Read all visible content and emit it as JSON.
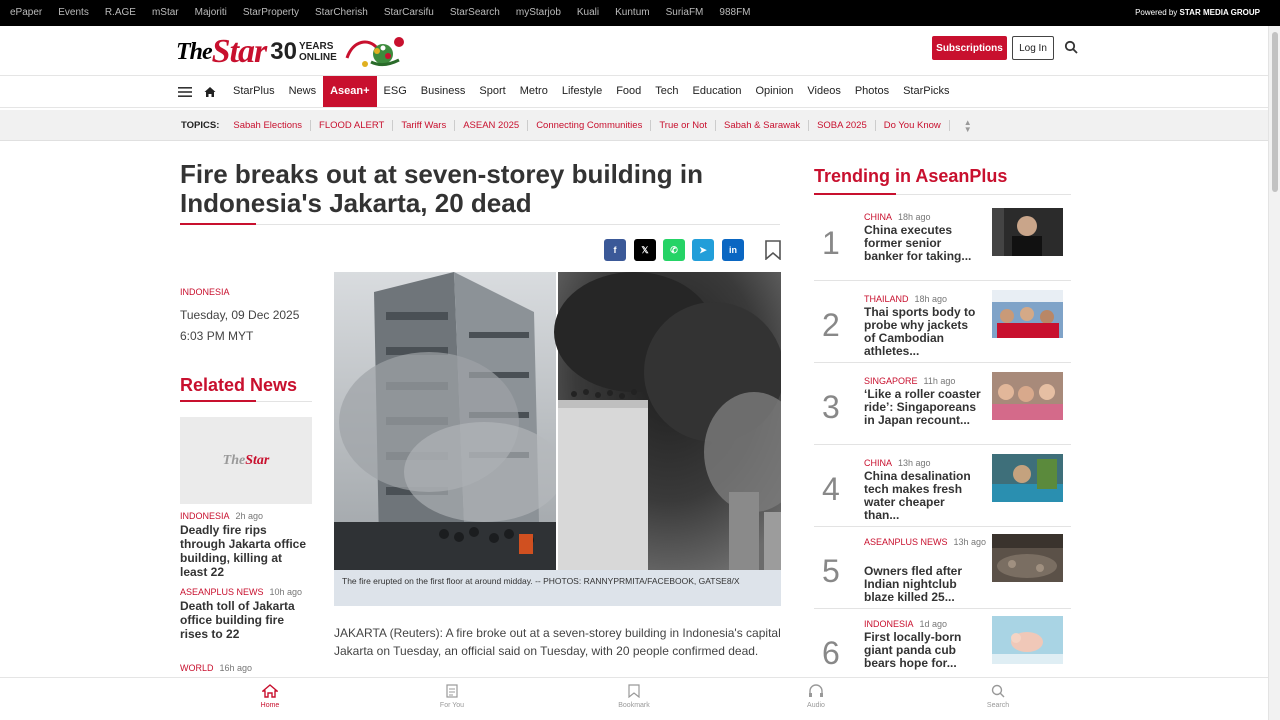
{
  "topbar": {
    "links": [
      "ePaper",
      "Events",
      "R.AGE",
      "mStar",
      "Majoriti",
      "StarProperty",
      "StarCherish",
      "StarCarsifu",
      "StarSearch",
      "myStarjob",
      "Kuali",
      "Kuntum",
      "SuriaFM",
      "988FM"
    ],
    "powered_by": "Powered by",
    "group": "STAR MEDIA GROUP"
  },
  "header": {
    "logo_the": "The",
    "logo_star": "Star",
    "logo_30": "30",
    "logo_years": "YEARS",
    "logo_online": "ONLINE",
    "subscriptions": "Subscriptions",
    "login": "Log In"
  },
  "nav": {
    "items": [
      "StarPlus",
      "News",
      "Asean+",
      "ESG",
      "Business",
      "Sport",
      "Metro",
      "Lifestyle",
      "Food",
      "Tech",
      "Education",
      "Opinion",
      "Videos",
      "Photos",
      "StarPicks"
    ],
    "active": "Asean+"
  },
  "topics": {
    "label": "TOPICS:",
    "items": [
      "Sabah Elections",
      "FLOOD ALERT",
      "Tariff Wars",
      "ASEAN 2025",
      "Connecting Communities",
      "True or Not",
      "Sabah & Sarawak",
      "SOBA 2025",
      "Do You Know"
    ]
  },
  "article": {
    "headline": "Fire breaks out at seven-storey building in Indonesia's Jakarta, 20 dead",
    "country": "INDONESIA",
    "date": "Tuesday, 09 Dec 2025",
    "time": "6:03 PM MYT",
    "caption": "The fire erupted on the first floor at around midday. -- PHOTOS: RANNYPRMITA/FACEBOOK, GATSE8/X",
    "body": "JAKARTA (Reuters): A fire broke out at a seven-storey building in Indonesia's capital Jakarta on Tuesday, an official said on Tuesday, with 20 people confirmed dead."
  },
  "share": {
    "facebook": "f",
    "x": "𝕏",
    "whatsapp": "✆",
    "telegram": "➤",
    "linkedin": "in"
  },
  "related": {
    "title": "Related News",
    "placeholder_the": "The",
    "placeholder_star": "Star",
    "items": [
      {
        "tag": "INDONESIA",
        "ago": "2h ago",
        "title": "Deadly fire rips through Jakarta office building, killing at least 22"
      },
      {
        "tag": "ASEANPLUS NEWS",
        "ago": "10h ago",
        "title": "Death toll of Jakarta office building fire rises to 22"
      },
      {
        "tag": "WORLD",
        "ago": "16h ago",
        "title": ""
      }
    ]
  },
  "trending": {
    "title": "Trending in AseanPlus",
    "items": [
      {
        "num": "1",
        "tag": "CHINA",
        "ago": "18h ago",
        "title": "China executes former senior banker for taking..."
      },
      {
        "num": "2",
        "tag": "THAILAND",
        "ago": "18h ago",
        "title": "Thai sports body to probe why jackets of Cambodian athletes..."
      },
      {
        "num": "3",
        "tag": "SINGAPORE",
        "ago": "11h ago",
        "title": "‘Like a roller coaster ride’: Singaporeans in Japan recount..."
      },
      {
        "num": "4",
        "tag": "CHINA",
        "ago": "13h ago",
        "title": "China desalination tech makes fresh water cheaper than..."
      },
      {
        "num": "5",
        "tag": "ASEANPLUS NEWS",
        "ago": "13h ago",
        "title": "Owners fled after Indian nightclub blaze killed 25..."
      },
      {
        "num": "6",
        "tag": "INDONESIA",
        "ago": "1d ago",
        "title": "First locally-born giant panda cub bears hope for..."
      }
    ]
  },
  "bottomnav": {
    "home": "Home",
    "foryou": "For You",
    "bookmark": "Bookmark",
    "audio": "Audio",
    "search": "Search"
  },
  "colors": {
    "brand": "#c8102e",
    "topbar": "#000000",
    "caption_bg": "#dde3ea"
  }
}
